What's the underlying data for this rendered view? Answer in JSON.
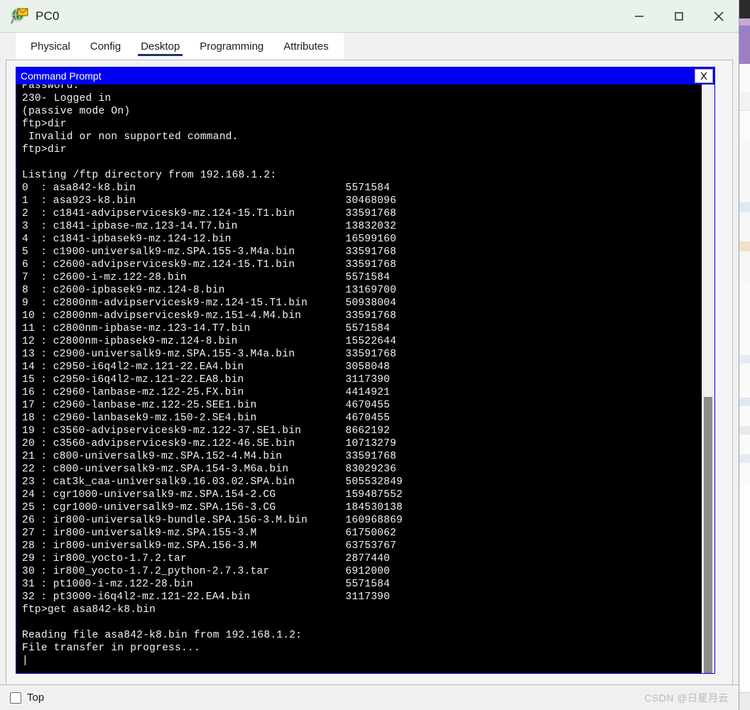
{
  "window": {
    "title": "PC0",
    "icon": "packet-tracer-pdu-icon",
    "controls": {
      "minimize": "minimize-icon",
      "maximize": "maximize-icon",
      "close": "close-icon"
    }
  },
  "tabs": [
    {
      "label": "Physical",
      "active": false
    },
    {
      "label": "Config",
      "active": false
    },
    {
      "label": "Desktop",
      "active": true
    },
    {
      "label": "Programming",
      "active": false
    },
    {
      "label": "Attributes",
      "active": false
    }
  ],
  "cmd_window": {
    "title": "Command Prompt",
    "close_label": "X"
  },
  "terminal": {
    "header_lines": [
      "Password:",
      "230- Logged in",
      "(passive mode On)",
      "ftp>dir",
      " Invalid or non supported command.",
      "ftp>dir",
      "",
      "Listing /ftp directory from 192.168.1.2:"
    ],
    "files": [
      {
        "index": "0",
        "name": "asa842-k8.bin",
        "size": "5571584"
      },
      {
        "index": "1",
        "name": "asa923-k8.bin",
        "size": "30468096"
      },
      {
        "index": "2",
        "name": "c1841-advipservicesk9-mz.124-15.T1.bin",
        "size": "33591768"
      },
      {
        "index": "3",
        "name": "c1841-ipbase-mz.123-14.T7.bin",
        "size": "13832032"
      },
      {
        "index": "4",
        "name": "c1841-ipbasek9-mz.124-12.bin",
        "size": "16599160"
      },
      {
        "index": "5",
        "name": "c1900-universalk9-mz.SPA.155-3.M4a.bin",
        "size": "33591768"
      },
      {
        "index": "6",
        "name": "c2600-advipservicesk9-mz.124-15.T1.bin",
        "size": "33591768"
      },
      {
        "index": "7",
        "name": "c2600-i-mz.122-28.bin",
        "size": "5571584"
      },
      {
        "index": "8",
        "name": "c2600-ipbasek9-mz.124-8.bin",
        "size": "13169700"
      },
      {
        "index": "9",
        "name": "c2800nm-advipservicesk9-mz.124-15.T1.bin",
        "size": "50938004"
      },
      {
        "index": "10",
        "name": "c2800nm-advipservicesk9-mz.151-4.M4.bin",
        "size": "33591768"
      },
      {
        "index": "11",
        "name": "c2800nm-ipbase-mz.123-14.T7.bin",
        "size": "5571584"
      },
      {
        "index": "12",
        "name": "c2800nm-ipbasek9-mz.124-8.bin",
        "size": "15522644"
      },
      {
        "index": "13",
        "name": "c2900-universalk9-mz.SPA.155-3.M4a.bin",
        "size": "33591768"
      },
      {
        "index": "14",
        "name": "c2950-i6q4l2-mz.121-22.EA4.bin",
        "size": "3058048"
      },
      {
        "index": "15",
        "name": "c2950-i6q4l2-mz.121-22.EA8.bin",
        "size": "3117390"
      },
      {
        "index": "16",
        "name": "c2960-lanbase-mz.122-25.FX.bin",
        "size": "4414921"
      },
      {
        "index": "17",
        "name": "c2960-lanbase-mz.122-25.SEE1.bin",
        "size": "4670455"
      },
      {
        "index": "18",
        "name": "c2960-lanbasek9-mz.150-2.SE4.bin",
        "size": "4670455"
      },
      {
        "index": "19",
        "name": "c3560-advipservicesk9-mz.122-37.SE1.bin",
        "size": "8662192"
      },
      {
        "index": "20",
        "name": "c3560-advipservicesk9-mz.122-46.SE.bin",
        "size": "10713279"
      },
      {
        "index": "21",
        "name": "c800-universalk9-mz.SPA.152-4.M4.bin",
        "size": "33591768"
      },
      {
        "index": "22",
        "name": "c800-universalk9-mz.SPA.154-3.M6a.bin",
        "size": "83029236"
      },
      {
        "index": "23",
        "name": "cat3k_caa-universalk9.16.03.02.SPA.bin",
        "size": "505532849"
      },
      {
        "index": "24",
        "name": "cgr1000-universalk9-mz.SPA.154-2.CG",
        "size": "159487552"
      },
      {
        "index": "25",
        "name": "cgr1000-universalk9-mz.SPA.156-3.CG",
        "size": "184530138"
      },
      {
        "index": "26",
        "name": "ir800-universalk9-bundle.SPA.156-3.M.bin",
        "size": "160968869"
      },
      {
        "index": "27",
        "name": "ir800-universalk9-mz.SPA.155-3.M",
        "size": "61750062"
      },
      {
        "index": "28",
        "name": "ir800-universalk9-mz.SPA.156-3.M",
        "size": "63753767"
      },
      {
        "index": "29",
        "name": "ir800_yocto-1.7.2.tar",
        "size": "2877440"
      },
      {
        "index": "30",
        "name": "ir800_yocto-1.7.2_python-2.7.3.tar",
        "size": "6912000"
      },
      {
        "index": "31",
        "name": "pt1000-i-mz.122-28.bin",
        "size": "5571584"
      },
      {
        "index": "32",
        "name": "pt3000-i6q4l2-mz.121-22.EA4.bin",
        "size": "3117390"
      }
    ],
    "footer_lines": [
      "ftp>get asa842-k8.bin",
      "",
      "Reading file asa842-k8.bin from 192.168.1.2:",
      "File transfer in progress..."
    ],
    "cursor": "|"
  },
  "status_bar": {
    "top_label": "Top",
    "top_checked": false,
    "watermark": "CSDN @日星月云"
  },
  "colors": {
    "cmd_title_bg": "#0000f0",
    "terminal_bg": "#000000",
    "terminal_fg": "#f2f2f2",
    "tab_active_underline": "#1f3864",
    "titlebar_bg": "#eaf2ec"
  }
}
